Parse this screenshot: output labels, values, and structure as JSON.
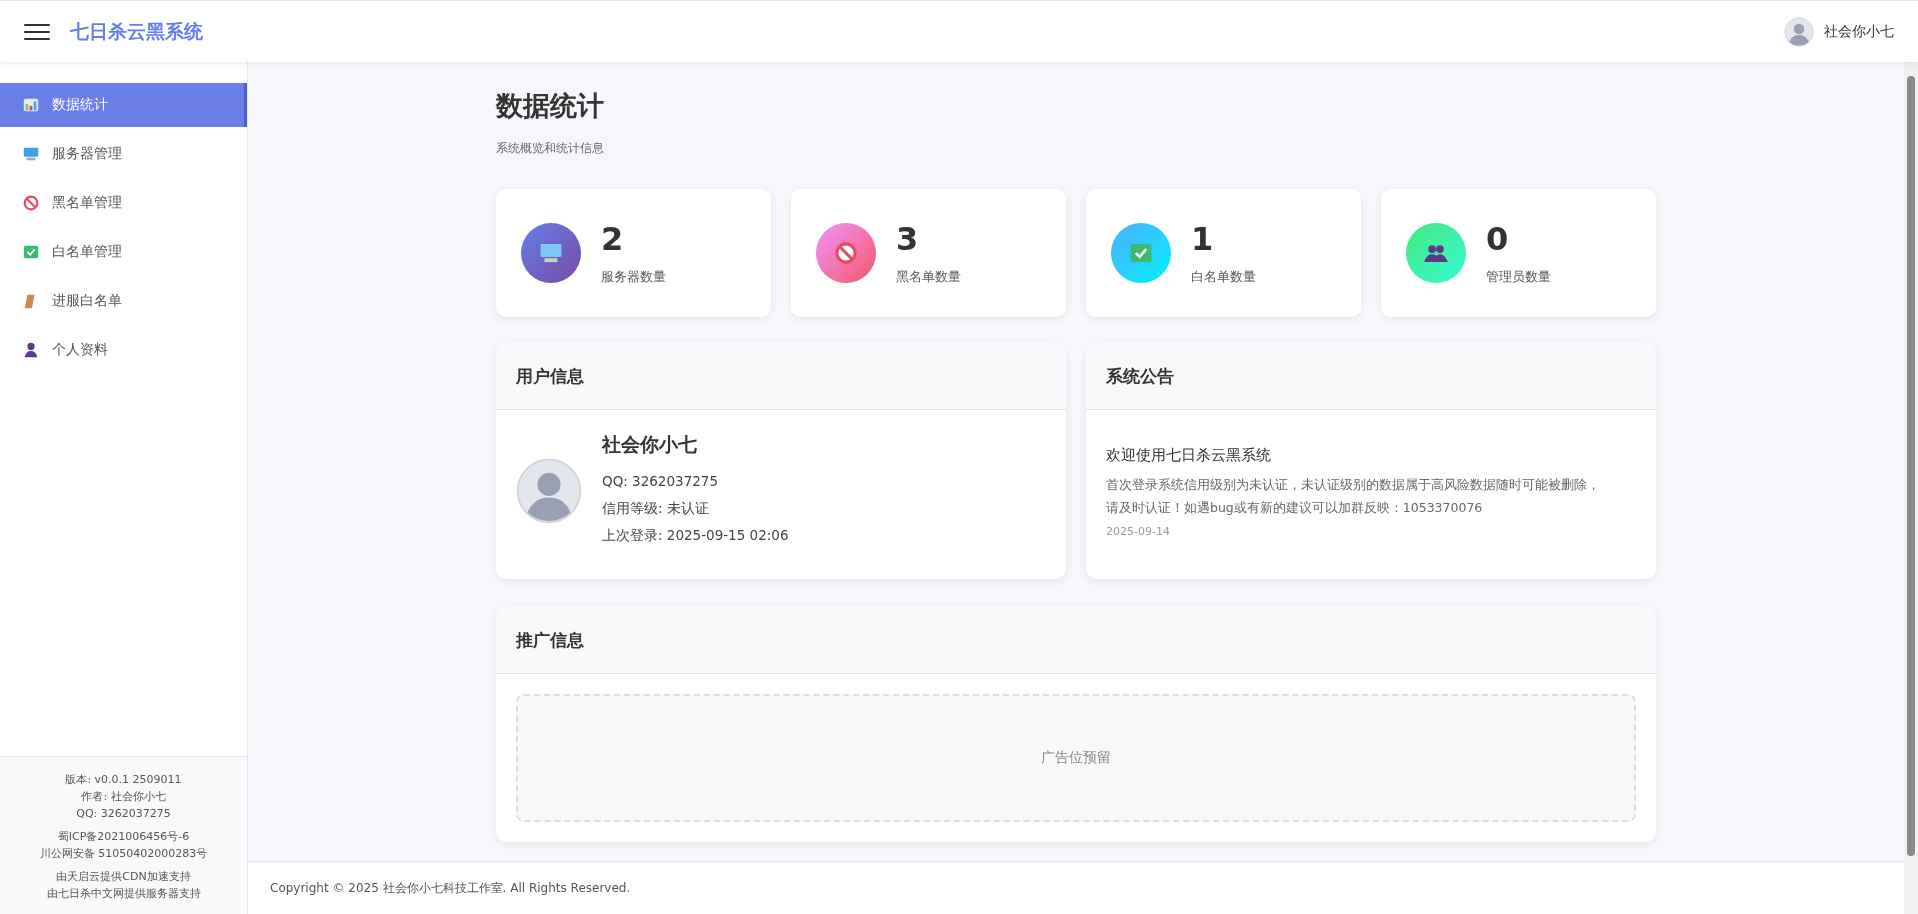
{
  "header": {
    "title": "七日杀云黑系统",
    "user_name": "社会你小七"
  },
  "sidebar": {
    "items": [
      {
        "label": "数据统计",
        "kind": "stats",
        "selected": true
      },
      {
        "label": "服务器管理",
        "kind": "server",
        "selected": false
      },
      {
        "label": "黑名单管理",
        "kind": "ban",
        "selected": false
      },
      {
        "label": "白名单管理",
        "kind": "check",
        "selected": false
      },
      {
        "label": "进服白名单",
        "kind": "pass",
        "selected": false
      },
      {
        "label": "个人资料",
        "kind": "person",
        "selected": false
      }
    ],
    "footer_groups": [
      [
        "版本: v0.0.1 2509011",
        "作者: 社会你小七",
        "QQ: 3262037275"
      ],
      [
        "蜀ICP备2021006456号-6",
        "川公网安备 51050402000283号"
      ],
      [
        "由天启云提供CDN加速支持",
        "由七日杀中文网提供服务器支持"
      ]
    ]
  },
  "page": {
    "title": "数据统计",
    "subtitle": "系统概览和统计信息"
  },
  "stats": [
    {
      "value": "2",
      "label": "服务器数量",
      "kind": "server"
    },
    {
      "value": "3",
      "label": "黑名单数量",
      "kind": "ban"
    },
    {
      "value": "1",
      "label": "白名单数量",
      "kind": "check"
    },
    {
      "value": "0",
      "label": "管理员数量",
      "kind": "admin"
    }
  ],
  "user_info": {
    "title": "用户信息",
    "name": "社会你小七",
    "lines": [
      "QQ: 3262037275",
      "信用等级: 未认证",
      "上次登录: 2025-09-15 02:06"
    ]
  },
  "announcement": {
    "title": "系统公告",
    "heading": "欢迎使用七日杀云黑系统",
    "body": "首次登录系统信用级别为未认证，未认证级别的数据属于高风险数据随时可能被删除，请及时认证！如遇bug或有新的建议可以加群反映：1053370076",
    "date": "2025-09-14"
  },
  "promo": {
    "title": "推广信息",
    "ad_label": "广告位预留"
  },
  "footer": {
    "copyright": "Copyright © 2025 社会你小七科技工作室. All Rights Reserved."
  }
}
